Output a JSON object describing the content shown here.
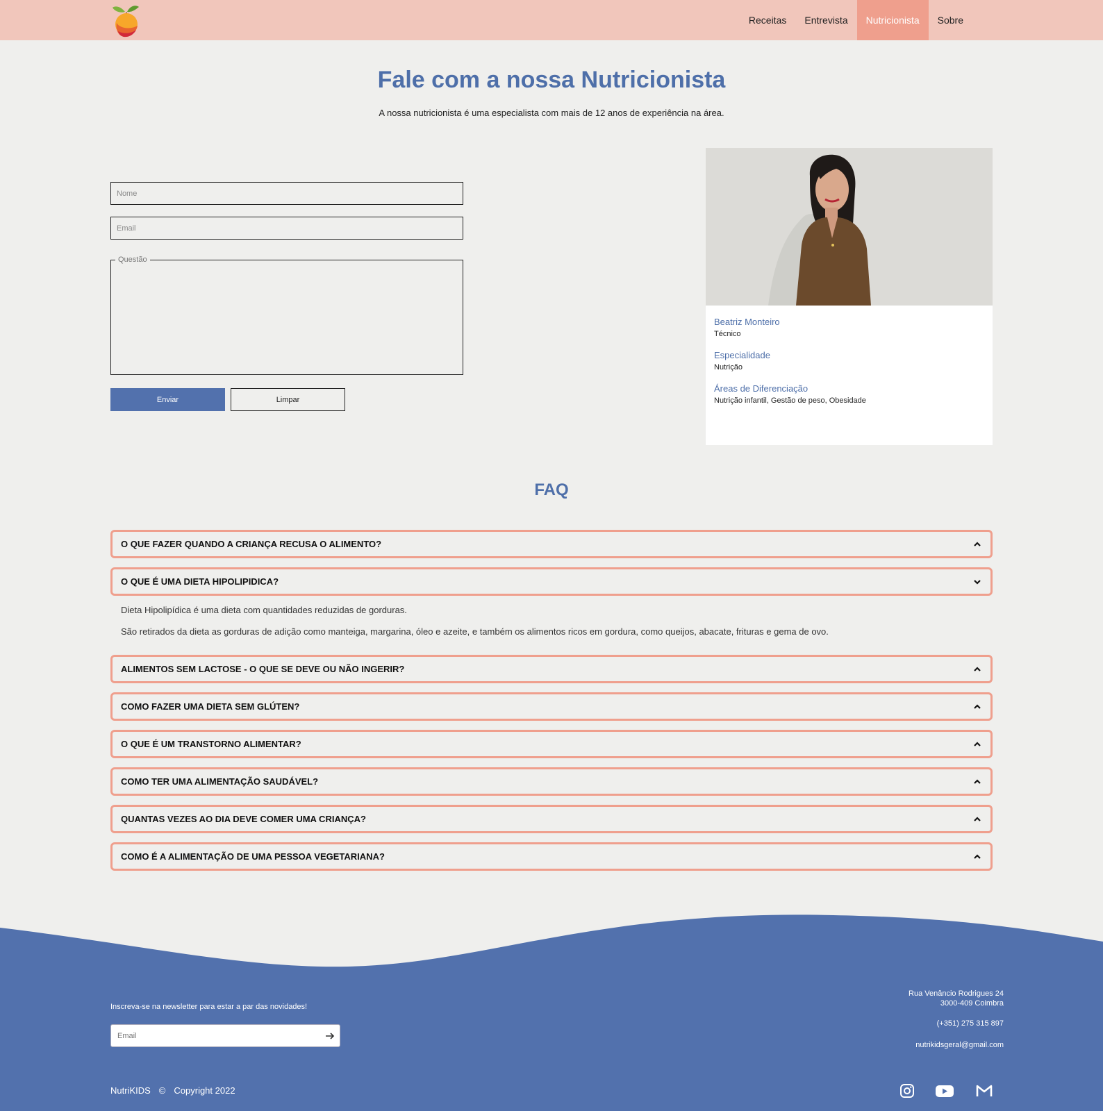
{
  "nav": {
    "items": [
      {
        "label": "Receitas",
        "active": false
      },
      {
        "label": "Entrevista",
        "active": false
      },
      {
        "label": "Nutricionista",
        "active": true
      },
      {
        "label": "Sobre",
        "active": false
      }
    ]
  },
  "hero": {
    "title": "Fale com a nossa Nutricionista",
    "subtitle": "A nossa nutricionista é uma especialista com mais de 12 anos de experiência na área."
  },
  "form": {
    "name_placeholder": "Nome",
    "email_placeholder": "Email",
    "question_legend": "Questão",
    "send_label": "Enviar",
    "clear_label": "Limpar"
  },
  "profile": {
    "name": "Beatriz Monteiro",
    "role": "Técnico",
    "specialty_label": "Especialidade",
    "specialty": "Nutrição",
    "areas_label": "Áreas de Diferenciação",
    "areas": "Nutrição infantil, Gestão de peso, Obesidade"
  },
  "faq": {
    "title": "FAQ",
    "items": [
      {
        "question": "O QUE FAZER QUANDO A CRIANÇA RECUSA O ALIMENTO?",
        "expanded": false
      },
      {
        "question": "O QUE É UMA DIETA HIPOLIPIDICA?",
        "expanded": true
      },
      {
        "question": "ALIMENTOS SEM LACTOSE - O QUE SE DEVE OU NÃO INGERIR?",
        "expanded": false
      },
      {
        "question": "COMO FAZER UMA DIETA SEM GLÚTEN?",
        "expanded": false
      },
      {
        "question": "O QUE É UM TRANSTORNO ALIMENTAR?",
        "expanded": false
      },
      {
        "question": "COMO TER UMA ALIMENTAÇÃO SAUDÁVEL?",
        "expanded": false
      },
      {
        "question": "QUANTAS VEZES AO DIA DEVE COMER UMA CRIANÇA?",
        "expanded": false
      },
      {
        "question": "COMO É A ALIMENTAÇÃO DE UMA PESSOA VEGETARIANA?",
        "expanded": false
      }
    ],
    "answer": {
      "p1": "Dieta Hipolipídica é uma dieta com quantidades reduzidas de gorduras.",
      "p2": "São retirados da dieta as gorduras de adição como manteiga, margarina, óleo e azeite, e também os alimentos ricos em gordura, como queijos, abacate, frituras e gema de ovo."
    }
  },
  "footer": {
    "newsletter_label": "Inscreva-se na newsletter para estar a par das novidades!",
    "newsletter_placeholder": "Email",
    "address_line1": "Rua Venâncio Rodrigues 24",
    "address_line2": "3000-409 Coimbra",
    "phone": "(+351) 275 315 897",
    "email": "nutrikidsgeral@gmail.com",
    "brand": "NutriKIDS",
    "copyright_symbol": "©",
    "copyright": "Copyright 2022",
    "social_icons": [
      "instagram-icon",
      "youtube-icon",
      "gmail-icon"
    ]
  },
  "colors": {
    "navbar": "#f1c6bb",
    "nav_active": "#ef9f8d",
    "accent_blue": "#4e6fa9",
    "button_blue": "#5271ad",
    "faq_border": "#ef9f8d",
    "footer": "#5271ad",
    "background": "#efefed"
  }
}
